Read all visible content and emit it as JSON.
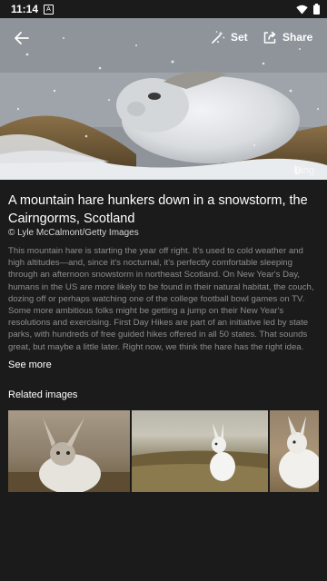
{
  "status_bar": {
    "time": "11:14",
    "app_badge": "A"
  },
  "toolbar": {
    "set_label": "Set",
    "share_label": "Share"
  },
  "hero": {
    "watermark": "Bing"
  },
  "article": {
    "title": "A mountain hare hunkers down in a snowstorm, the Cairngorms, Scotland",
    "credit": "© Lyle McCalmont/Getty Images",
    "description": "This mountain hare is starting the year off right. It's used to cold weather and high altitudes—and, since it's nocturnal, it's perfectly comfortable sleeping through an afternoon snowstorm in northeast Scotland. On New Year's Day, humans in the US are more likely to be found in their natural habitat, the couch, dozing off or perhaps watching one of the college football bowl games on TV. Some more ambitious folks might be getting a jump on their New Year's resolutions and exercising. First Day Hikes are part of an initiative led by state parks, with hundreds of free guided hikes offered in all 50 states. That sounds great, but maybe a little later. Right now, we think the hare has the right idea.",
    "see_more": "See more"
  },
  "related": {
    "title": "Related images"
  },
  "icons": {
    "back": "back-arrow-icon",
    "set": "magic-wand-icon",
    "share": "share-icon",
    "bing": "bing-logo-icon",
    "wifi": "wifi-icon",
    "battery": "battery-icon"
  }
}
